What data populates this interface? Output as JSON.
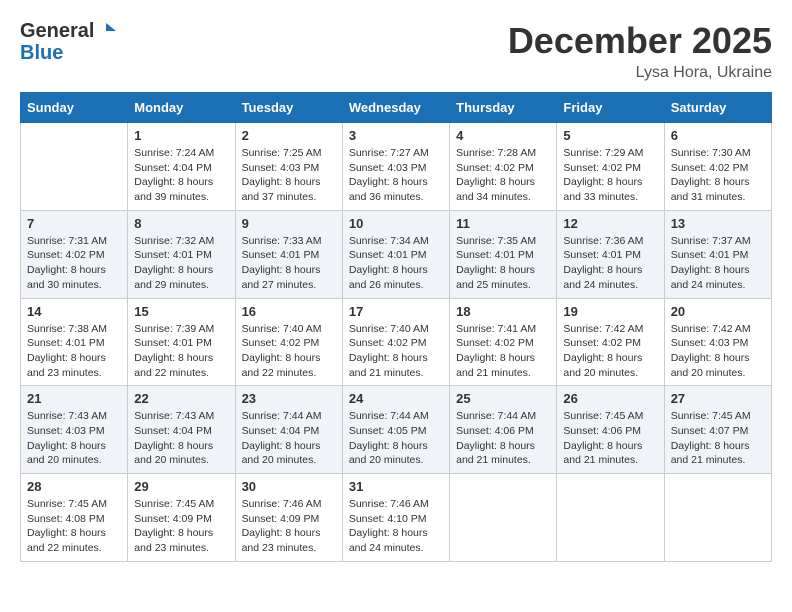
{
  "logo": {
    "line1": "General",
    "line2": "Blue"
  },
  "header": {
    "month": "December 2025",
    "location": "Lysa Hora, Ukraine"
  },
  "weekdays": [
    "Sunday",
    "Monday",
    "Tuesday",
    "Wednesday",
    "Thursday",
    "Friday",
    "Saturday"
  ],
  "weeks": [
    [
      {
        "day": "",
        "info": ""
      },
      {
        "day": "1",
        "info": "Sunrise: 7:24 AM\nSunset: 4:04 PM\nDaylight: 8 hours\nand 39 minutes."
      },
      {
        "day": "2",
        "info": "Sunrise: 7:25 AM\nSunset: 4:03 PM\nDaylight: 8 hours\nand 37 minutes."
      },
      {
        "day": "3",
        "info": "Sunrise: 7:27 AM\nSunset: 4:03 PM\nDaylight: 8 hours\nand 36 minutes."
      },
      {
        "day": "4",
        "info": "Sunrise: 7:28 AM\nSunset: 4:02 PM\nDaylight: 8 hours\nand 34 minutes."
      },
      {
        "day": "5",
        "info": "Sunrise: 7:29 AM\nSunset: 4:02 PM\nDaylight: 8 hours\nand 33 minutes."
      },
      {
        "day": "6",
        "info": "Sunrise: 7:30 AM\nSunset: 4:02 PM\nDaylight: 8 hours\nand 31 minutes."
      }
    ],
    [
      {
        "day": "7",
        "info": "Sunrise: 7:31 AM\nSunset: 4:02 PM\nDaylight: 8 hours\nand 30 minutes."
      },
      {
        "day": "8",
        "info": "Sunrise: 7:32 AM\nSunset: 4:01 PM\nDaylight: 8 hours\nand 29 minutes."
      },
      {
        "day": "9",
        "info": "Sunrise: 7:33 AM\nSunset: 4:01 PM\nDaylight: 8 hours\nand 27 minutes."
      },
      {
        "day": "10",
        "info": "Sunrise: 7:34 AM\nSunset: 4:01 PM\nDaylight: 8 hours\nand 26 minutes."
      },
      {
        "day": "11",
        "info": "Sunrise: 7:35 AM\nSunset: 4:01 PM\nDaylight: 8 hours\nand 25 minutes."
      },
      {
        "day": "12",
        "info": "Sunrise: 7:36 AM\nSunset: 4:01 PM\nDaylight: 8 hours\nand 24 minutes."
      },
      {
        "day": "13",
        "info": "Sunrise: 7:37 AM\nSunset: 4:01 PM\nDaylight: 8 hours\nand 24 minutes."
      }
    ],
    [
      {
        "day": "14",
        "info": "Sunrise: 7:38 AM\nSunset: 4:01 PM\nDaylight: 8 hours\nand 23 minutes."
      },
      {
        "day": "15",
        "info": "Sunrise: 7:39 AM\nSunset: 4:01 PM\nDaylight: 8 hours\nand 22 minutes."
      },
      {
        "day": "16",
        "info": "Sunrise: 7:40 AM\nSunset: 4:02 PM\nDaylight: 8 hours\nand 22 minutes."
      },
      {
        "day": "17",
        "info": "Sunrise: 7:40 AM\nSunset: 4:02 PM\nDaylight: 8 hours\nand 21 minutes."
      },
      {
        "day": "18",
        "info": "Sunrise: 7:41 AM\nSunset: 4:02 PM\nDaylight: 8 hours\nand 21 minutes."
      },
      {
        "day": "19",
        "info": "Sunrise: 7:42 AM\nSunset: 4:02 PM\nDaylight: 8 hours\nand 20 minutes."
      },
      {
        "day": "20",
        "info": "Sunrise: 7:42 AM\nSunset: 4:03 PM\nDaylight: 8 hours\nand 20 minutes."
      }
    ],
    [
      {
        "day": "21",
        "info": "Sunrise: 7:43 AM\nSunset: 4:03 PM\nDaylight: 8 hours\nand 20 minutes."
      },
      {
        "day": "22",
        "info": "Sunrise: 7:43 AM\nSunset: 4:04 PM\nDaylight: 8 hours\nand 20 minutes."
      },
      {
        "day": "23",
        "info": "Sunrise: 7:44 AM\nSunset: 4:04 PM\nDaylight: 8 hours\nand 20 minutes."
      },
      {
        "day": "24",
        "info": "Sunrise: 7:44 AM\nSunset: 4:05 PM\nDaylight: 8 hours\nand 20 minutes."
      },
      {
        "day": "25",
        "info": "Sunrise: 7:44 AM\nSunset: 4:06 PM\nDaylight: 8 hours\nand 21 minutes."
      },
      {
        "day": "26",
        "info": "Sunrise: 7:45 AM\nSunset: 4:06 PM\nDaylight: 8 hours\nand 21 minutes."
      },
      {
        "day": "27",
        "info": "Sunrise: 7:45 AM\nSunset: 4:07 PM\nDaylight: 8 hours\nand 21 minutes."
      }
    ],
    [
      {
        "day": "28",
        "info": "Sunrise: 7:45 AM\nSunset: 4:08 PM\nDaylight: 8 hours\nand 22 minutes."
      },
      {
        "day": "29",
        "info": "Sunrise: 7:45 AM\nSunset: 4:09 PM\nDaylight: 8 hours\nand 23 minutes."
      },
      {
        "day": "30",
        "info": "Sunrise: 7:46 AM\nSunset: 4:09 PM\nDaylight: 8 hours\nand 23 minutes."
      },
      {
        "day": "31",
        "info": "Sunrise: 7:46 AM\nSunset: 4:10 PM\nDaylight: 8 hours\nand 24 minutes."
      },
      {
        "day": "",
        "info": ""
      },
      {
        "day": "",
        "info": ""
      },
      {
        "day": "",
        "info": ""
      }
    ]
  ]
}
